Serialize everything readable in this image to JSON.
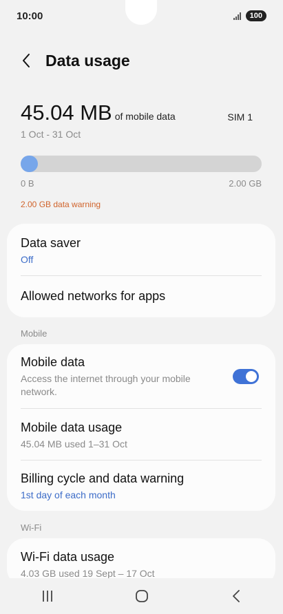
{
  "status_bar": {
    "time": "10:00",
    "battery": "100"
  },
  "header": {
    "title": "Data usage",
    "back_icon": "chevron-left-icon"
  },
  "usage": {
    "amount": "45.04 MB",
    "suffix": "of mobile data",
    "sim": "SIM 1",
    "period": "1 Oct - 31 Oct",
    "bar_min": "0 B",
    "bar_max": "2.00 GB",
    "fraction_used": 0.022,
    "warning": "2.00 GB data warning",
    "accent_color": "#77a6ea",
    "warning_color": "#d0632b"
  },
  "general_card": {
    "data_saver": {
      "title": "Data saver",
      "status": "Off"
    },
    "allowed_networks": {
      "title": "Allowed networks for apps"
    }
  },
  "mobile_section": {
    "header": "Mobile",
    "mobile_data": {
      "title": "Mobile data",
      "description": "Access the internet through your mobile network.",
      "enabled": true
    },
    "mobile_data_usage": {
      "title": "Mobile data usage",
      "subtitle": "45.04 MB used 1–31 Oct"
    },
    "billing_cycle": {
      "title": "Billing cycle and data warning",
      "subtitle": "1st day of each month"
    }
  },
  "wifi_section": {
    "header": "Wi-Fi",
    "wifi_data_usage": {
      "title": "Wi-Fi data usage",
      "subtitle": "4.03 GB used 19 Sept – 17 Oct"
    }
  },
  "nav": {
    "recents_icon": "recents-icon",
    "home_icon": "home-icon",
    "back_icon": "back-icon"
  }
}
